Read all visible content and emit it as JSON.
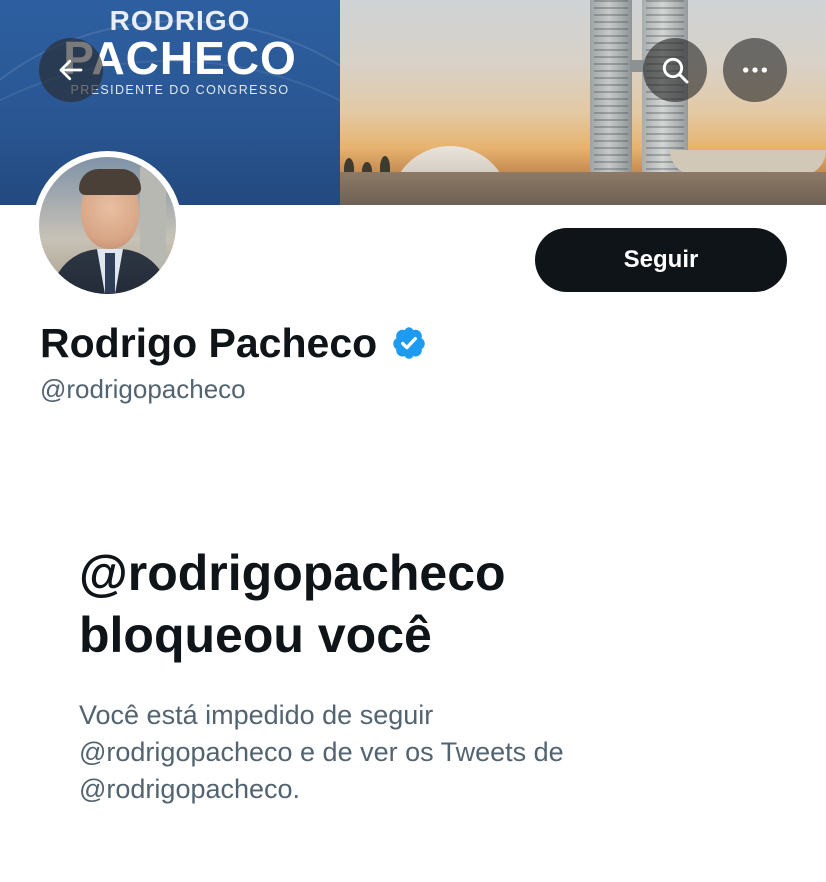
{
  "banner": {
    "logo_line1": "RODRIGO",
    "logo_line2": "PACHECO",
    "logo_line3": "PRESIDENTE DO CONGRESSO",
    "brand_blue": "#2a5794"
  },
  "nav": {
    "back_icon": "arrow-left-icon",
    "search_icon": "search-icon",
    "more_icon": "more-horizontal-icon"
  },
  "profile": {
    "display_name": "Rodrigo Pacheco",
    "handle": "@rodrigopacheco",
    "verified": true,
    "verified_color": "#1d9bf0",
    "follow_label": "Seguir"
  },
  "blocked": {
    "title_line1": "@rodrigopacheco",
    "title_line2": "bloqueou você",
    "desc_line1": "Você está impedido de seguir",
    "desc_line2": "@rodrigopacheco e de ver os Tweets de",
    "desc_line3": "@rodrigopacheco."
  }
}
